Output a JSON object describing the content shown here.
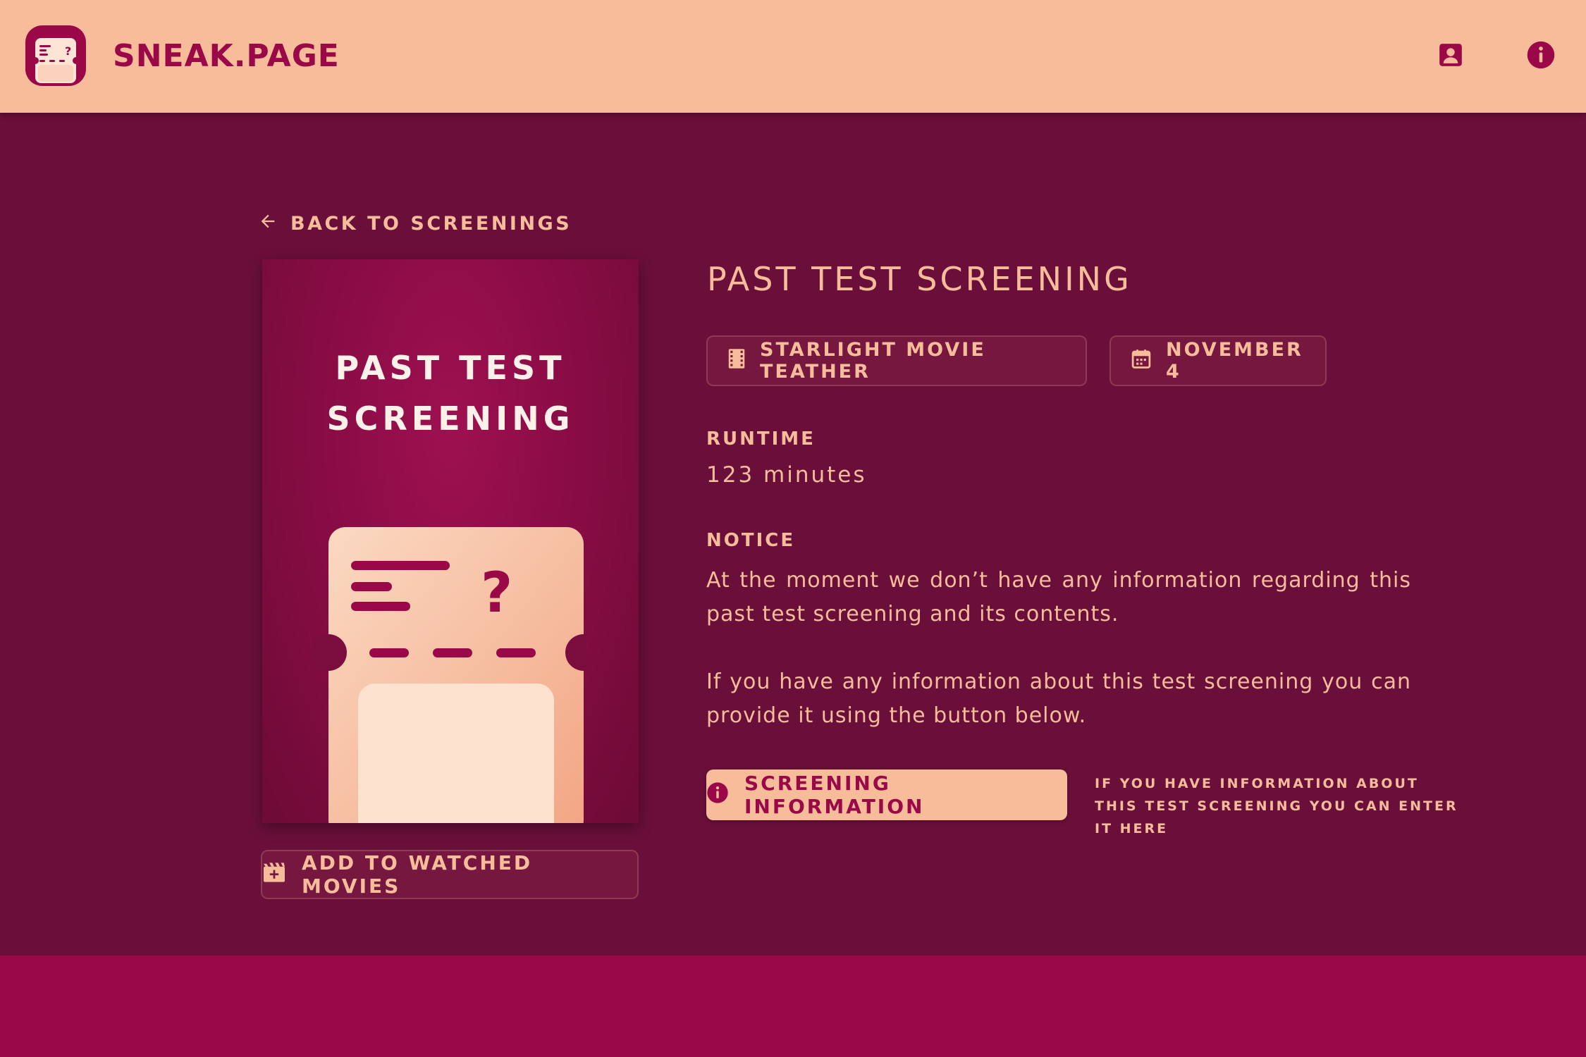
{
  "header": {
    "brand": "SNEAK.PAGE",
    "logo_icon": "ticket-question-icon",
    "profile_icon": "account-box-icon",
    "info_icon": "info-circle-icon"
  },
  "nav": {
    "back_label": "BACK TO SCREENINGS",
    "back_icon": "arrow-left-icon"
  },
  "poster": {
    "title": "PAST TEST\nSCREENING",
    "artwork_icon": "ticket-question-icon"
  },
  "actions": {
    "watched_label": "ADD TO WATCHED MOVIES",
    "watched_icon": "movie-add-icon",
    "info_button_label": "SCREENING INFORMATION",
    "info_button_icon": "info-circle-icon",
    "info_hint": "IF YOU HAVE INFORMATION ABOUT THIS TEST SCREENING YOU CAN ENTER IT HERE"
  },
  "details": {
    "title": "PAST TEST SCREENING",
    "cinema": "STARLIGHT MOVIE TEATHER",
    "cinema_icon": "film-icon",
    "date": "NOVEMBER 4",
    "date_icon": "calendar-icon",
    "runtime_label": "RUNTIME",
    "runtime_value": "123 minutes",
    "notice_label": "NOTICE",
    "notice_p1": "At the moment we don’t have any information regarding this past test screening and its contents.",
    "notice_p2": "If you have any information about this test screening you can provide it using the button below."
  },
  "colors": {
    "header_bg": "#f7bc9a",
    "main_bg": "#6a0f3a",
    "accent": "#9a0848",
    "text_light": "#f7bc9a"
  }
}
